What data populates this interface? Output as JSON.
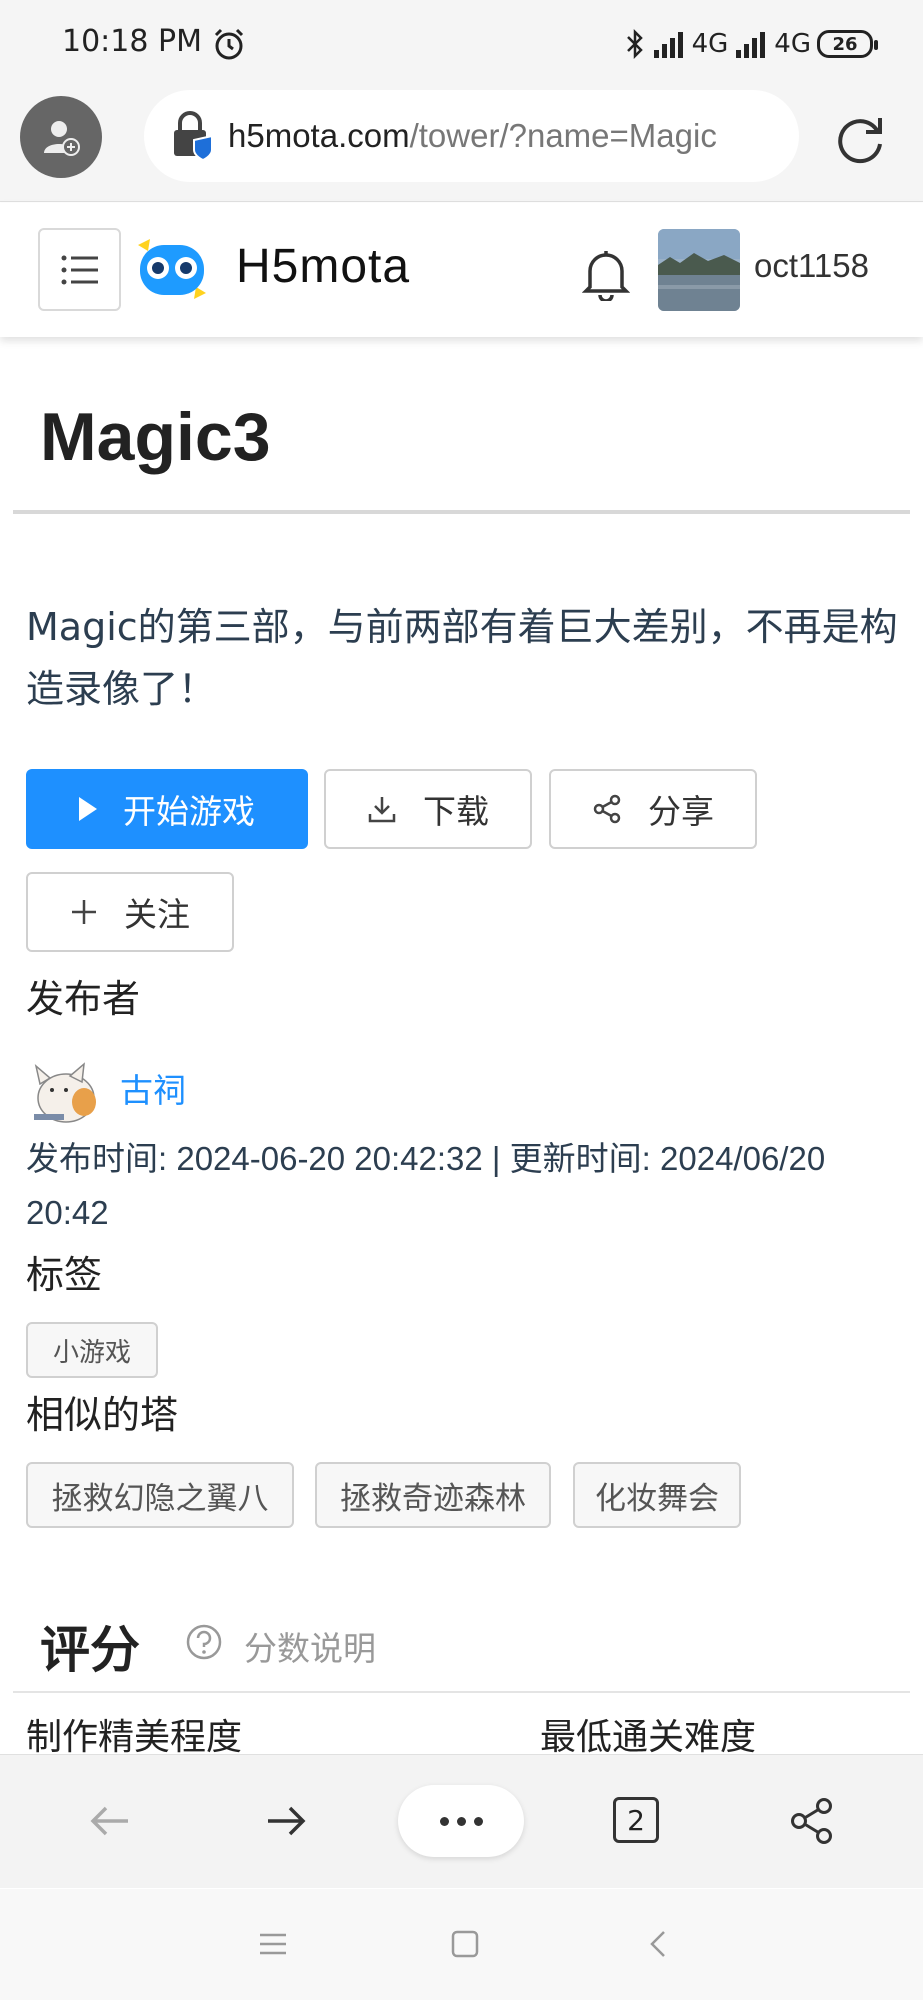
{
  "status_bar": {
    "time": "10:18 PM",
    "network_1": "4G",
    "network_2": "4G",
    "battery": "26"
  },
  "browser": {
    "url_host": "h5mota.com",
    "url_path": "/tower/?name=Magic",
    "tab_count": "2"
  },
  "header": {
    "logo_text": "H5mota",
    "username": "oct1158"
  },
  "page": {
    "title": "Magic3",
    "description": "Magic的第三部，与前两部有着巨大差别，不再是构造录像了！",
    "buttons": {
      "start": "开始游戏",
      "download": "下载",
      "share": "分享",
      "follow": "关注"
    },
    "publisher_label": "发布者",
    "author_name": "古祠",
    "meta": "发布时间: 2024-06-20 20:42:32 | 更新时间: 2024/06/20 20:42",
    "tags_label": "标签",
    "tags": [
      "小游戏"
    ],
    "similar_label": "相似的塔",
    "similar_towers": [
      "拯救幻隐之翼八",
      "拯救奇迹森林",
      "化妆舞会"
    ],
    "rating": {
      "title": "评分",
      "help": "分数说明",
      "col_1": "制作精美程度",
      "col_2": "最低通关难度"
    }
  },
  "colors": {
    "primary": "#1e90ff",
    "text_dark": "#2c3e50"
  }
}
